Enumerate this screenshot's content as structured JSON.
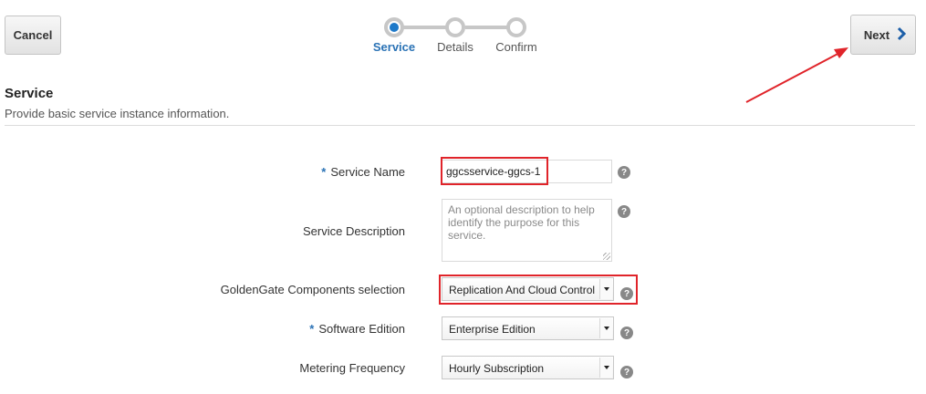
{
  "toolbar": {
    "cancel_label": "Cancel",
    "next_label": "Next"
  },
  "train": {
    "steps": [
      {
        "label": "Service",
        "active": true
      },
      {
        "label": "Details",
        "active": false
      },
      {
        "label": "Confirm",
        "active": false
      }
    ]
  },
  "section": {
    "title": "Service",
    "description": "Provide basic service instance information."
  },
  "form": {
    "required_marker": "*",
    "service_name": {
      "label": "Service Name",
      "value": "ggcsservice-ggcs-1",
      "required": true
    },
    "service_description": {
      "label": "Service Description",
      "placeholder": "An optional description to help identify the purpose for this service."
    },
    "components": {
      "label": "GoldenGate Components selection",
      "value": "Replication And Cloud Control"
    },
    "software_edition": {
      "label": "Software Edition",
      "value": "Enterprise Edition",
      "required": true
    },
    "metering_frequency": {
      "label": "Metering Frequency",
      "value": "Hourly Subscription"
    },
    "help_glyph": "?"
  },
  "colors": {
    "accent": "#1d79c9",
    "highlight": "#e0242a"
  },
  "icons": {
    "next": "chevron-right-icon",
    "help": "help-icon",
    "dropdown": "dropdown-caret-icon"
  }
}
